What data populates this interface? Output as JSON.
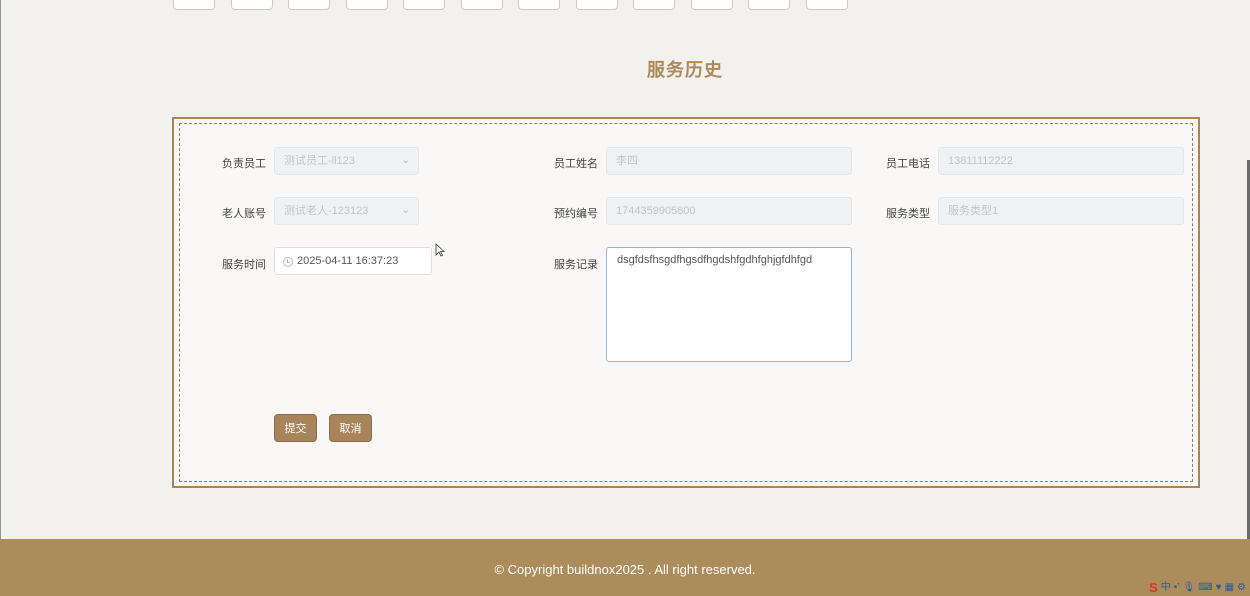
{
  "page": {
    "title": "服务历史"
  },
  "form": {
    "fields": [
      {
        "label": "负责员工",
        "value": "测试员工-ll123",
        "type": "select"
      },
      {
        "label": "员工姓名",
        "value": "李四",
        "type": "text"
      },
      {
        "label": "员工电话",
        "value": "13811112222",
        "type": "text"
      },
      {
        "label": "老人账号",
        "value": "测试老人-123123",
        "type": "select"
      },
      {
        "label": "预约编号",
        "value": "1744359905800",
        "type": "text"
      },
      {
        "label": "服务类型",
        "value": "服务类型1",
        "type": "text"
      },
      {
        "label": "服务时间",
        "value": "2025-04-11 16:37:23",
        "type": "datetime"
      },
      {
        "label": "服务记录",
        "value": "dsgfdsfhsgdfhgsdfhgdshfgdhfghjgfdhfgd",
        "type": "textarea"
      }
    ],
    "submit_label": "提交",
    "cancel_label": "取消"
  },
  "footer": {
    "copyright": "© Copyright buildnox2025 . All right reserved."
  },
  "tray": {
    "ime": "S",
    "lang": "中"
  },
  "colors": {
    "accent": "#a8845a",
    "footer_bg": "#ad8c5c",
    "page_bg": "#f3f1ee"
  }
}
